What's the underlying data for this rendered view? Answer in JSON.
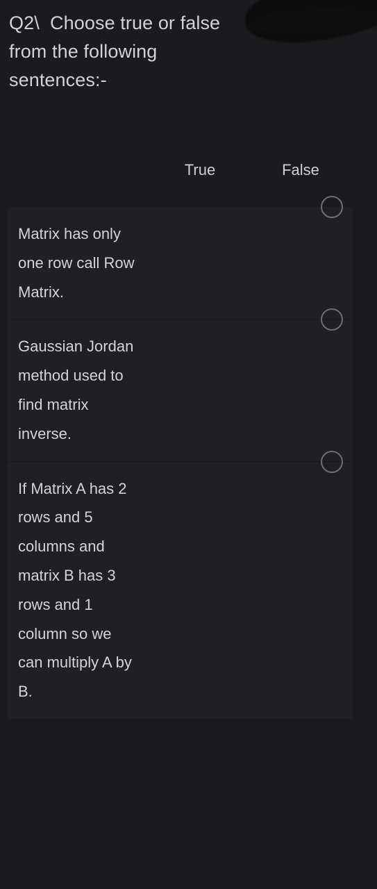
{
  "page": {
    "background_color": "#1b1b1d",
    "card_background_color": "#202023",
    "text_color": "#d4d4d6",
    "radio_border_color": "#6d6d73"
  },
  "question": {
    "heading": "Q2\\  Choose true or false from the following sentences:-"
  },
  "columns": [
    {
      "key": "true",
      "label": "True"
    },
    {
      "key": "false",
      "label": "False"
    }
  ],
  "rows": [
    {
      "statement": "Matrix has only one row call Row Matrix.",
      "true_selected": false,
      "false_selected": false
    },
    {
      "statement": "Gaussian Jordan method used to find matrix inverse.",
      "true_selected": false,
      "false_selected": false
    },
    {
      "statement": "If Matrix A has 2 rows and 5 columns and matrix B has 3 rows and 1 column so we can multiply A by B.",
      "true_selected": false,
      "false_selected": false
    }
  ],
  "decorations": {
    "redaction_blob_color": "#0c0c0c"
  }
}
